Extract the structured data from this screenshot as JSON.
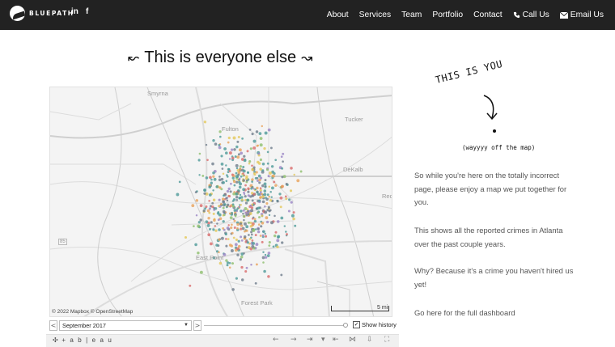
{
  "brand": {
    "name": "BLUEPATH",
    "logo_icon": "bluepath-logo-icon"
  },
  "social": {
    "linkedin": "in",
    "facebook": "f"
  },
  "nav": {
    "items": [
      {
        "label": "About",
        "icon": ""
      },
      {
        "label": "Services",
        "icon": ""
      },
      {
        "label": "Team",
        "icon": ""
      },
      {
        "label": "Portfolio",
        "icon": ""
      },
      {
        "label": "Contact",
        "icon": ""
      },
      {
        "label": "Call Us",
        "icon": "phone-icon"
      },
      {
        "label": "Email Us",
        "icon": "envelope-icon"
      }
    ]
  },
  "headline": {
    "text": "This is everyone else",
    "left_arrow": "↜",
    "right_arrow": "↝"
  },
  "map": {
    "places": [
      "Smyrna",
      "Fulton",
      "Tucker",
      "DeKalb",
      "Redi",
      "East Point",
      "Forest Park",
      "85"
    ],
    "credit": "© 2022 Mapbox © OpenStreetMap",
    "scale_label": "5 mi",
    "colors": {
      "teal": "#4e9a98",
      "slate": "#6f7d8c",
      "orange": "#e8a25b",
      "red": "#d96b6b",
      "green": "#8fbf6e",
      "yellow": "#e4c85a",
      "purple": "#9a84c4"
    }
  },
  "controls": {
    "prev": "<",
    "next": ">",
    "month": "September 2017",
    "show_history_label": "Show history",
    "show_history_checked": true
  },
  "tableau": {
    "brand": "+ a b | e a u"
  },
  "right": {
    "title": "THIS IS YOU",
    "note": "(wayyyy off the map)",
    "paragraphs": [
      "So while you're here on the totally incorrect page, please enjoy a map we put together for you.",
      "This shows all the reported crimes in Atlanta over the past couple years.",
      "Why? Because it's a crime you haven't hired us yet!",
      "Go here for the full dashboard"
    ]
  }
}
